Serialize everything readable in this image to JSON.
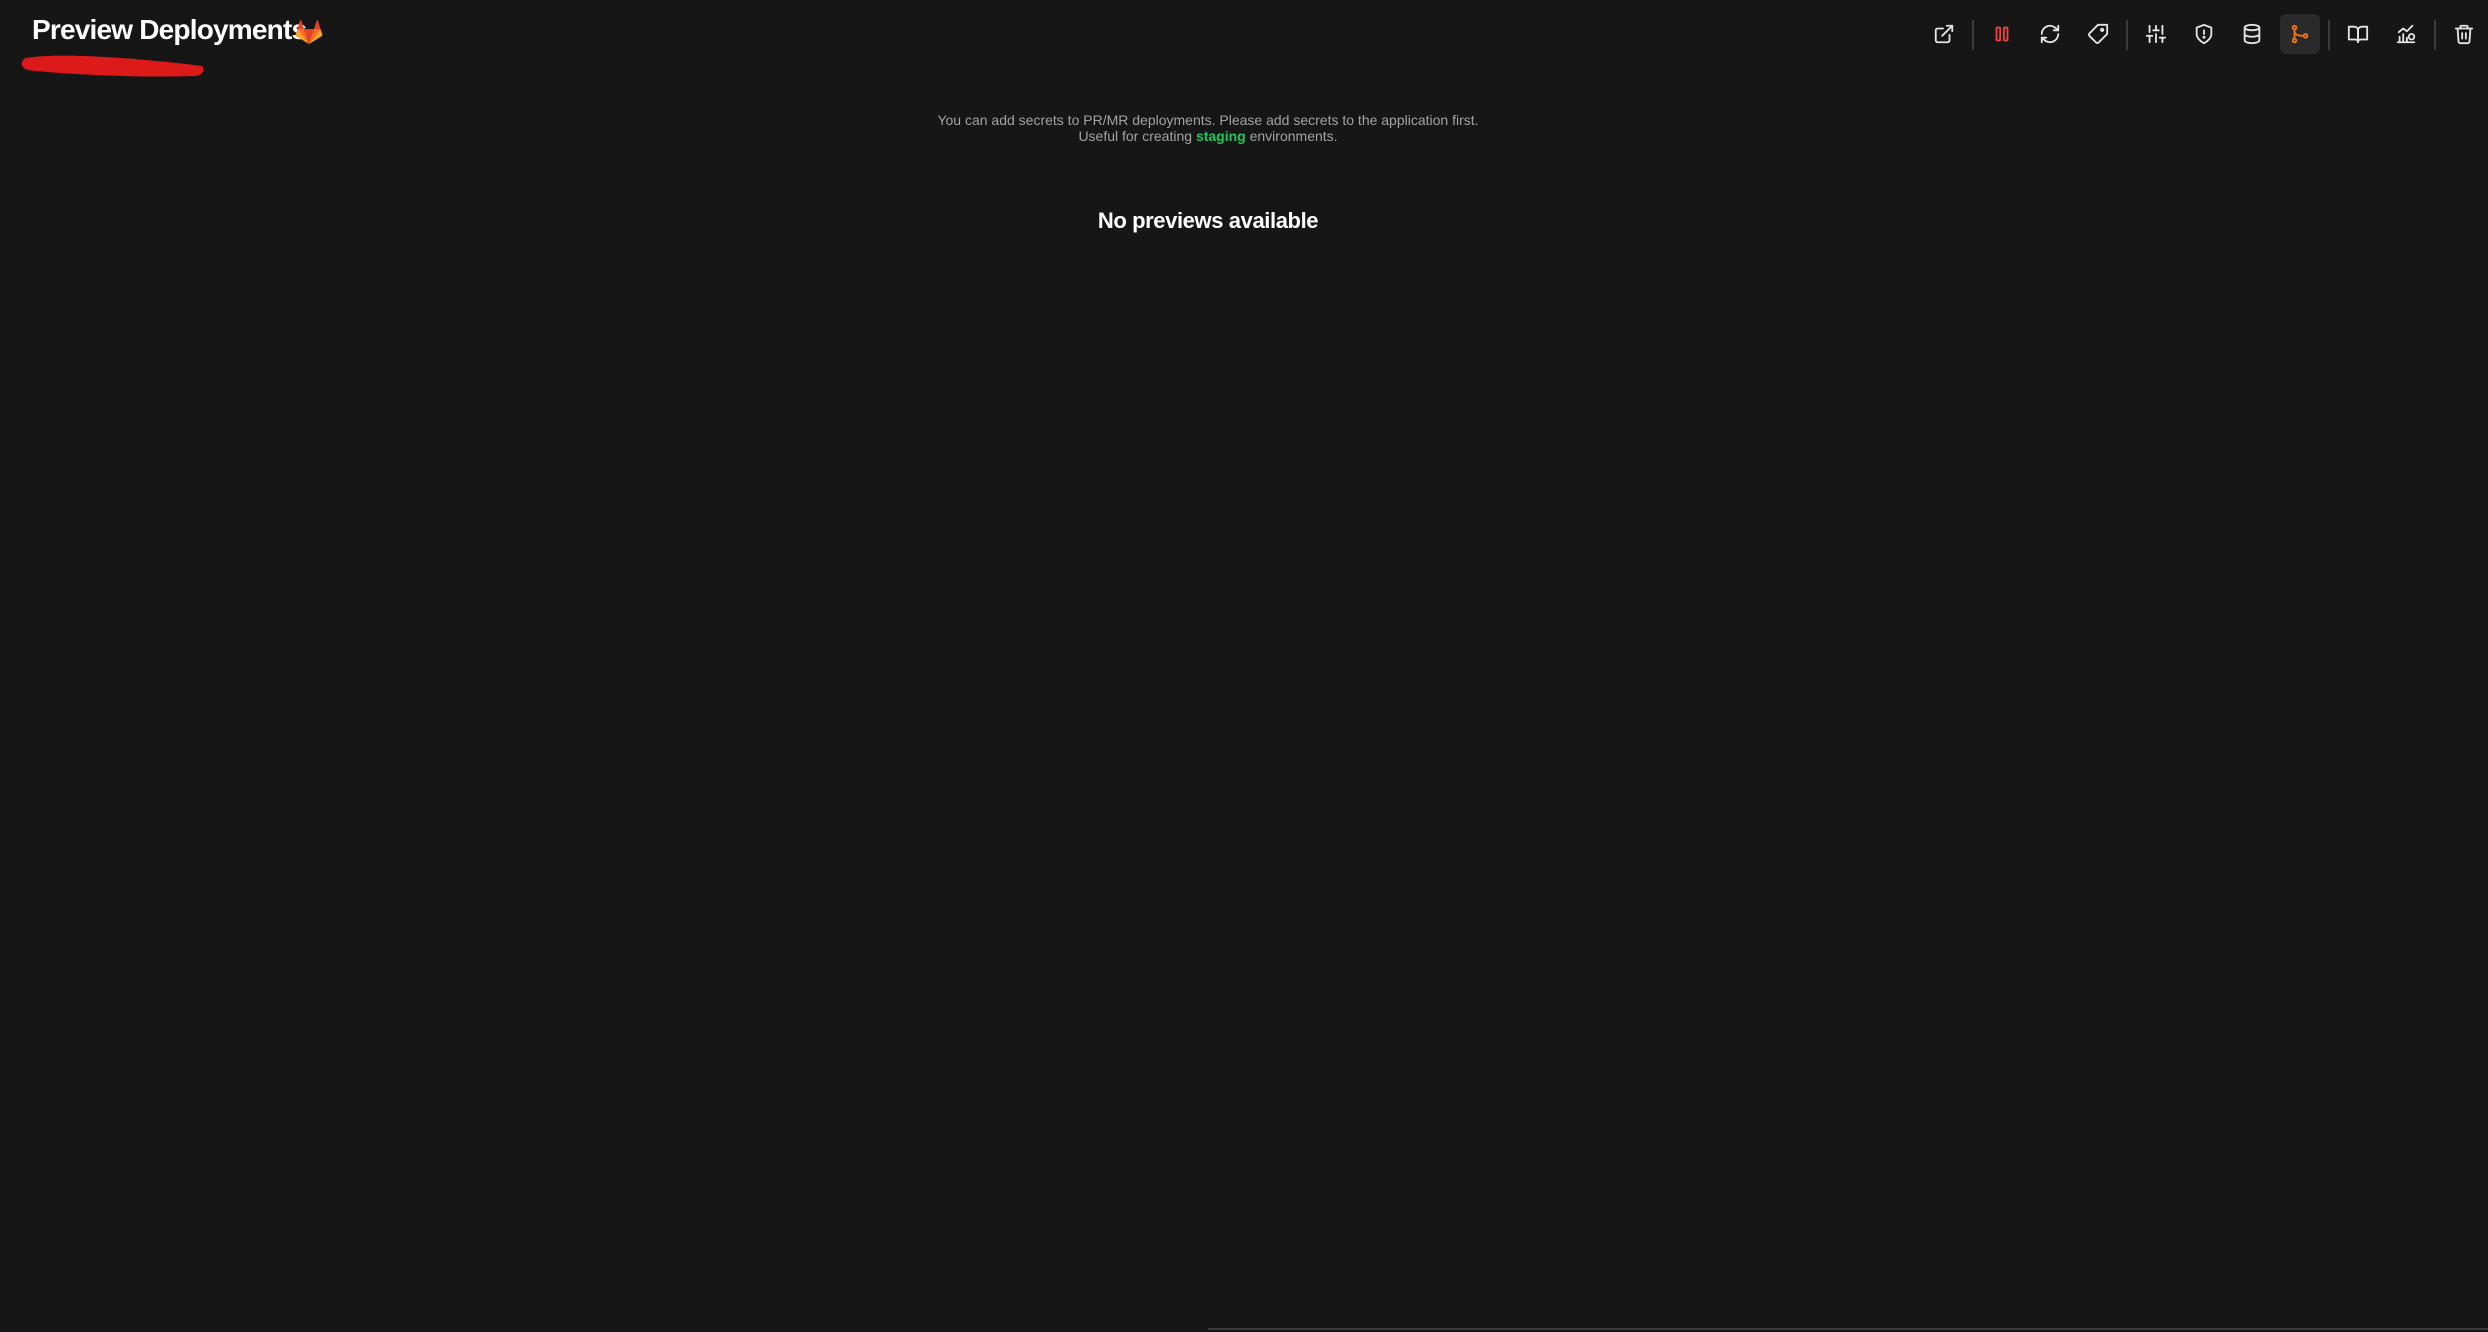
{
  "header": {
    "title": "Preview Deployments",
    "provider_icon": "gitlab-icon",
    "redaction_color": "#dc1a1a"
  },
  "toolbar": {
    "icons": [
      "external-link-icon",
      "stop-icon",
      "restart-icon",
      "tag-icon",
      "settings-sliders-icon",
      "shield-icon",
      "database-icon",
      "git-branch-icon",
      "book-icon",
      "stats-icon",
      "trash-icon"
    ],
    "active_icon": "git-branch-icon",
    "stop_color": "#ef4444",
    "active_color": "#f97316"
  },
  "info": {
    "line1": "You can add secrets to PR/MR deployments. Please add secrets to the application first.",
    "line2_prefix": "Useful for creating",
    "line2_highlight": "staging",
    "line2_suffix": "environments.",
    "highlight_color": "#22c55e"
  },
  "empty_state": {
    "message": "No previews available"
  }
}
